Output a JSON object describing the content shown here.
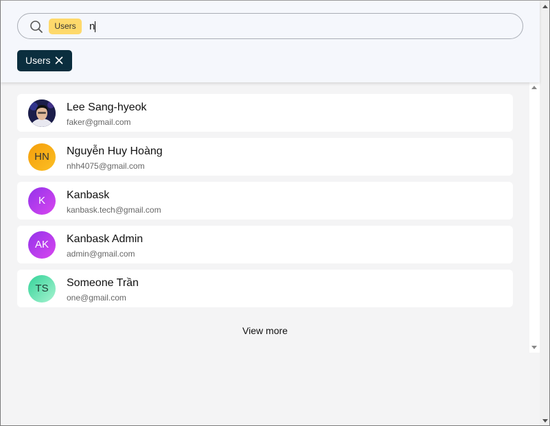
{
  "search": {
    "chip_label": "Users",
    "query": "n"
  },
  "filter": {
    "chip_label": "Users"
  },
  "results": [
    {
      "name": "Lee Sang-hyeok",
      "email": "faker@gmail.com",
      "initials": "",
      "avatar": "photo"
    },
    {
      "name": "Nguyễn Huy Hoàng",
      "email": "nhh4075@gmail.com",
      "initials": "HN",
      "avatar": "gradient-orange"
    },
    {
      "name": "Kanbask",
      "email": "kanbask.tech@gmail.com",
      "initials": "K",
      "avatar": "gradient-purple"
    },
    {
      "name": "Kanbask Admin",
      "email": "admin@gmail.com",
      "initials": "AK",
      "avatar": "gradient-purple"
    },
    {
      "name": "Someone Trần",
      "email": "one@gmail.com",
      "initials": "TS",
      "avatar": "gradient-green"
    }
  ],
  "view_more_label": "View more",
  "colors": {
    "chip_yellow": "#fed96b",
    "filter_chip_bg": "#0b2e3e",
    "avatar_orange": "#f59e0b",
    "avatar_purple": "#a21caf",
    "avatar_green": "#6ee7b7"
  }
}
